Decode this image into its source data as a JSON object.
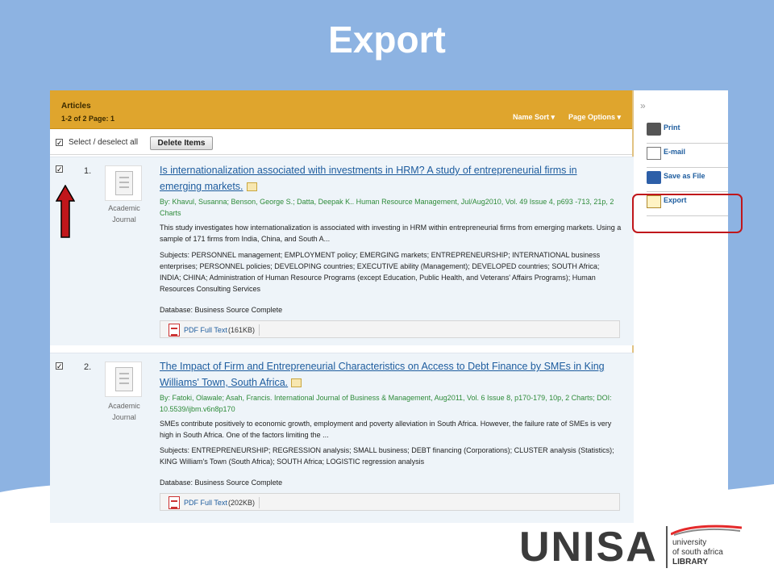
{
  "slide": {
    "title": "Export"
  },
  "header": {
    "title": "Articles",
    "summary": "1-2 of 2  Page: 1",
    "name_sort": "Name Sort ▾",
    "page_options": "Page Options ▾"
  },
  "toolbar": {
    "select_label": "Select / deselect all",
    "delete_label": "Delete Items"
  },
  "results": [
    {
      "number": "1.",
      "type_line1": "Academic",
      "type_line2": "Journal",
      "title_part1": "Is internationalization associated with investments in HRM? A study of entrepreneurial firms in",
      "title_part2": "emerging markets.",
      "byline": "By: Khavul, Susanna; Benson, George S.; Datta, Deepak K.. Human Resource Management, Jul/Aug2010, Vol. 49 Issue 4, p693 -713, 21p, 2 Charts",
      "abstract": "This study investigates how internationalization is associated with investing in HRM within entrepreneurial firms from emerging markets. Using a sample of 171 firms from India, China, and South A...",
      "subjects": "Subjects: PERSONNEL management; EMPLOYMENT policy; EMERGING markets; ENTREPRENEURSHIP; INTERNATIONAL business enterprises; PERSONNEL policies; DEVELOPING countries; EXECUTIVE ability (Management); DEVELOPED countries; SOUTH Africa; INDIA; CHINA; Administration of Human Resource Programs (except Education, Public Health, and Veterans' Affairs Programs); Human Resources Consulting Services",
      "database": "Database: Business Source Complete",
      "pdf_label": "PDF Full Text",
      "pdf_size": "(161KB)"
    },
    {
      "number": "2.",
      "type_line1": "Academic",
      "type_line2": "Journal",
      "title_part1": "The Impact of Firm and Entrepreneurial Characteristics on Access to Debt Finance by SMEs in King",
      "title_part2": "Williams' Town, South Africa.",
      "byline": "By: Fatoki, Olawale; Asah, Francis. International Journal of Business & Management, Aug2011, Vol. 6 Issue 8, p170-179, 10p, 2 Charts; DOI: 10.5539/ijbm.v6n8p170",
      "abstract": "SMEs contribute positively to economic growth, employment and poverty alleviation in South Africa. However, the failure rate of SMEs is very high in South Africa. One of the factors limiting the ...",
      "subjects": "Subjects: ENTREPRENEURSHIP; REGRESSION analysis; SMALL business; DEBT financing (Corporations); CLUSTER analysis (Statistics); KING William's Town (South Africa); SOUTH Africa; LOGISTIC regression analysis",
      "database": "Database: Business Source Complete",
      "pdf_label": "PDF Full Text",
      "pdf_size": "(202KB)"
    }
  ],
  "sidebar": {
    "collapse": "»",
    "items": [
      {
        "label": "Print",
        "icon": "printer-icon"
      },
      {
        "label": "E-mail",
        "icon": "email-icon"
      },
      {
        "label": "Save as File",
        "icon": "save-icon"
      },
      {
        "label": "Export",
        "icon": "export-icon"
      }
    ]
  },
  "logo": {
    "word": "UNISA",
    "line1": "university",
    "line2": "of south africa",
    "line3": "LIBRARY"
  },
  "colors": {
    "background": "#8db3e2",
    "header": "#dfa52d",
    "link": "#1d5c9e",
    "highlight": "#c0161b"
  }
}
